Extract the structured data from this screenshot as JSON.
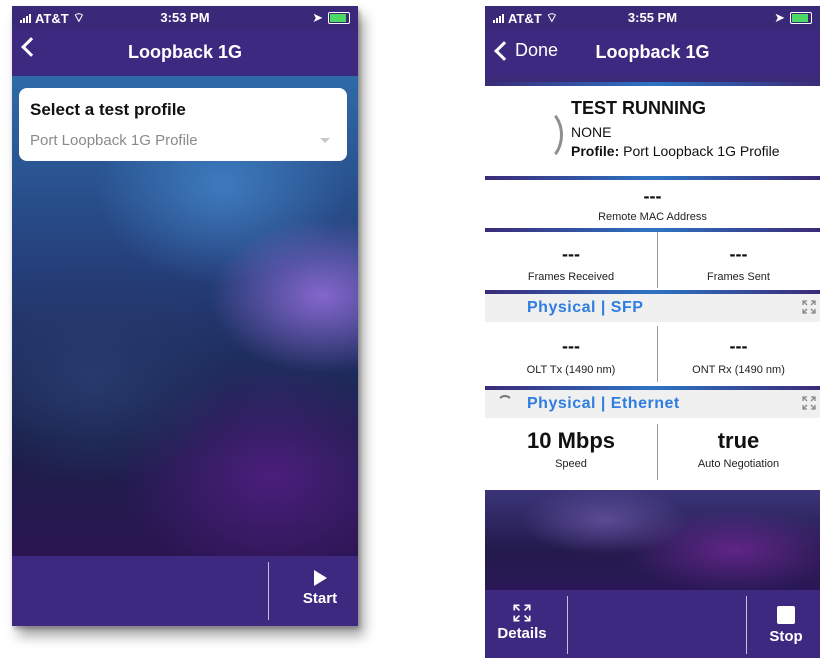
{
  "screen1": {
    "status": {
      "carrier": "AT&T",
      "time": "3:53 PM"
    },
    "nav": {
      "title": "Loopback 1G"
    },
    "card": {
      "heading": "Select a test profile",
      "selected_profile": "Port Loopback 1G Profile"
    },
    "toolbar": {
      "start_label": "Start"
    }
  },
  "screen2": {
    "status": {
      "carrier": "AT&T",
      "time": "3:55 PM"
    },
    "nav": {
      "back_label": "Done",
      "title": "Loopback 1G"
    },
    "run": {
      "status": "TEST RUNNING",
      "sub": "NONE",
      "profile_label": "Profile:",
      "profile_value": "Port Loopback 1G Profile"
    },
    "remote_mac": {
      "value": "---",
      "label": "Remote MAC Address"
    },
    "frames": {
      "received": {
        "value": "---",
        "label": "Frames Received"
      },
      "sent": {
        "value": "---",
        "label": "Frames Sent"
      }
    },
    "physical_sfp": {
      "title": "Physical | SFP",
      "olt_tx": {
        "value": "---",
        "label": "OLT Tx (1490 nm)"
      },
      "ont_rx": {
        "value": "---",
        "label": "ONT Rx (1490 nm)"
      }
    },
    "physical_ethernet": {
      "title": "Physical | Ethernet",
      "speed": {
        "value": "10 Mbps",
        "label": "Speed"
      },
      "auto_neg": {
        "value": "true",
        "label": "Auto Negotiation"
      }
    },
    "toolbar": {
      "details_label": "Details",
      "stop_label": "Stop"
    }
  },
  "colors": {
    "brand_purple": "#3d2a80",
    "accent_blue": "#2f7de0"
  }
}
